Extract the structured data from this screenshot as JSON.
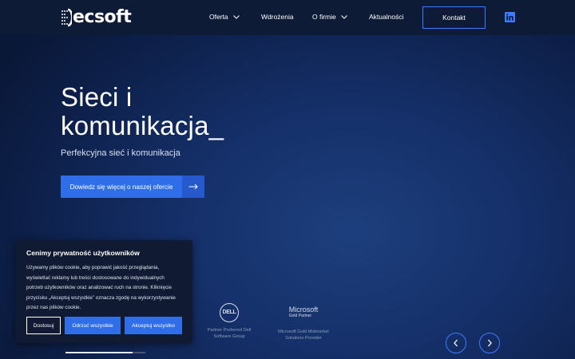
{
  "header": {
    "logo_text": "ecsoft",
    "nav": [
      {
        "label": "Oferta",
        "has_dropdown": true
      },
      {
        "label": "Wdrożenia",
        "has_dropdown": false
      },
      {
        "label": "O firmie",
        "has_dropdown": true
      },
      {
        "label": "Aktualności",
        "has_dropdown": false
      }
    ],
    "contact_label": "Kontakt",
    "social_icon": "linkedin-icon"
  },
  "hero": {
    "title_line1": "Sieci i",
    "title_line2": "komunikacja_",
    "subtitle": "Perfekcyjna sieć i komunikacja",
    "cta_label": "Dowiedz się więcej o naszej ofercie",
    "cta_icon": "arrow-right-icon"
  },
  "partners": [
    {
      "logo": "DELL",
      "caption_line1": "Partner Preferred Dell",
      "caption_line2": "Software Group"
    },
    {
      "logo": "Microsoft",
      "logo_sub": "Gold Partner",
      "caption_line1": "Microsoft Gold Midmarket",
      "caption_line2": "Solutions Provider"
    }
  ],
  "carousel": {
    "prev_icon": "chevron-left-icon",
    "next_icon": "chevron-right-icon",
    "progress_fraction": 0.84
  },
  "cookie": {
    "title": "Cenimy prywatność użytkowników",
    "text": "Używamy plików cookie, aby poprawić jakość przeglądania, wyświetlać reklamy lub treści dostosowane do indywidualnych potrzeb użytkowników oraz analizować ruch na stronie. Kliknięcie przycisku „Akceptuj wszystkie” oznacza zgodę na wykorzystywanie przez nas plików cookie.",
    "btn_customize": "Dostosuj",
    "btn_reject": "Odrzuć wszystkie",
    "btn_accept": "Akceptuj wszystko"
  },
  "colors": {
    "accent": "#2f6ee8",
    "header_bg": "#0e1b36",
    "cookie_bg": "#101a33"
  }
}
